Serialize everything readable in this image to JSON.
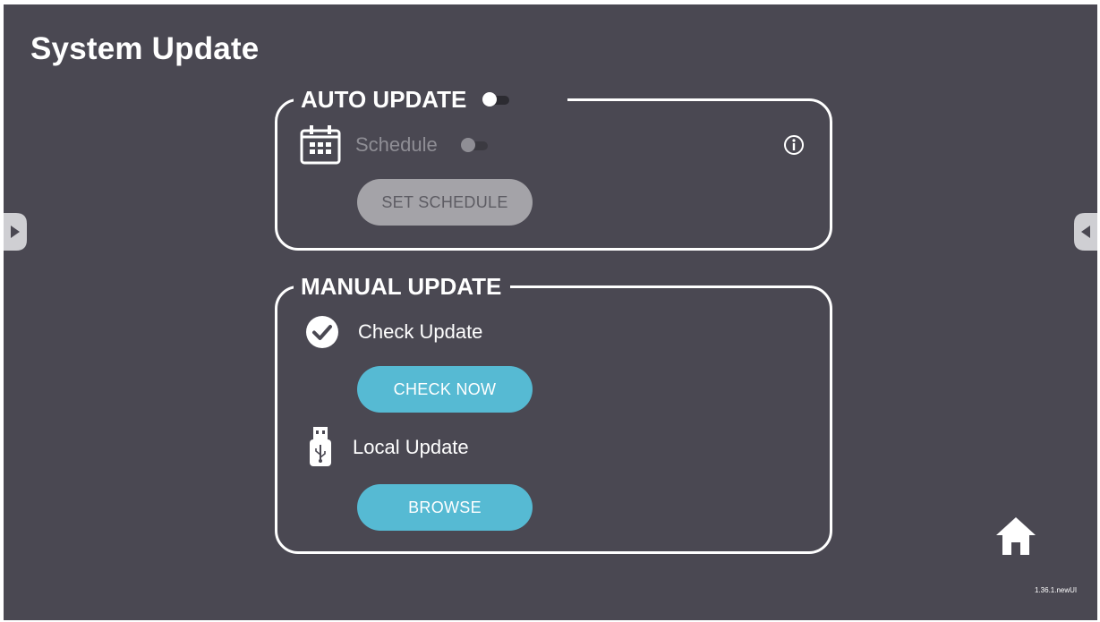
{
  "page": {
    "title": "System Update",
    "version": "1.36.1.newUI"
  },
  "auto_update": {
    "title": "AUTO UPDATE",
    "enabled": false,
    "schedule_label": "Schedule",
    "schedule_enabled": false,
    "set_schedule_label": "SET SCHEDULE",
    "icons": {
      "calendar": "calendar-icon",
      "info": "info-icon"
    }
  },
  "manual_update": {
    "title": "MANUAL UPDATE",
    "check_update_label": "Check Update",
    "check_now_label": "CHECK NOW",
    "local_update_label": "Local Update",
    "browse_label": "BROWSE",
    "icons": {
      "check": "check-circle-icon",
      "usb": "usb-drive-icon"
    }
  },
  "nav": {
    "left": "chevron-right-icon",
    "right": "chevron-left-icon",
    "home": "home-icon"
  },
  "colors": {
    "background": "#4a4852",
    "accent": "#56bad3",
    "disabled": "#a4a3a8",
    "panel_border": "#ffffff"
  }
}
